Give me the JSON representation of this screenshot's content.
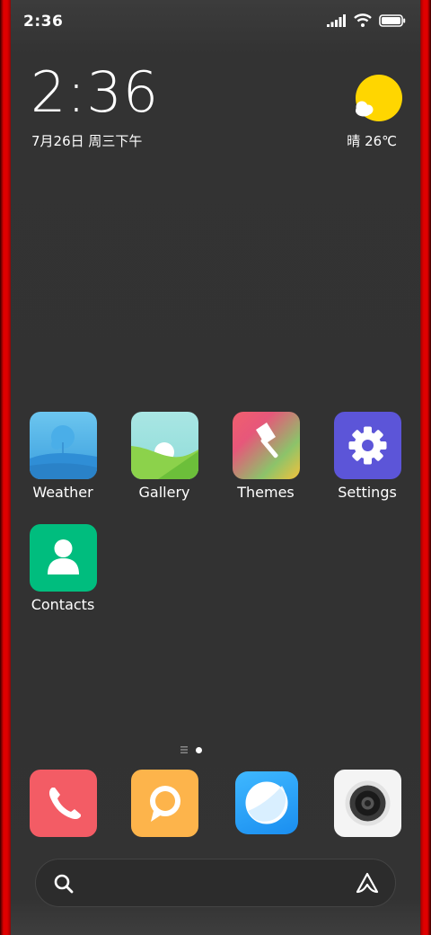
{
  "status_bar": {
    "time": "2:36"
  },
  "clock_widget": {
    "time": "2:36",
    "date": "7月26日 周三下午",
    "weather": "晴 26℃"
  },
  "apps": [
    {
      "label": "Weather"
    },
    {
      "label": "Gallery"
    },
    {
      "label": "Themes"
    },
    {
      "label": "Settings"
    },
    {
      "label": "Contacts"
    }
  ],
  "dock": [
    "phone-icon",
    "messages-icon",
    "browser-icon",
    "camera-icon"
  ],
  "search": {
    "left_icon": "search-icon",
    "right_icon": "assistant-icon"
  },
  "page_indicator": {
    "pages": 2,
    "active": 2
  },
  "colors": {
    "weather_sun": "#FFD600",
    "phone": "#F35C65",
    "messages": "#FDB44B",
    "settings": "#5C55D8",
    "contacts": "#00BD7E",
    "browser": "#1A9BF5"
  }
}
